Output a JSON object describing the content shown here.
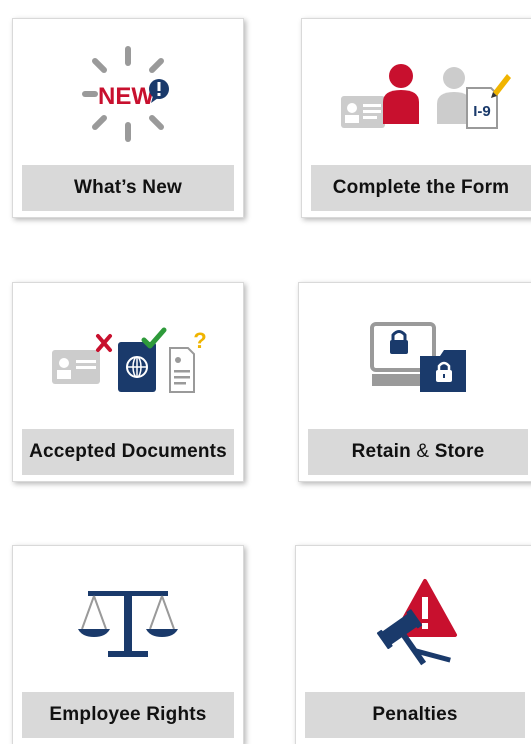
{
  "tiles": [
    {
      "label": "What’s New",
      "icon": "new-icon"
    },
    {
      "label": "Complete the Form",
      "icon": "form-icon"
    },
    {
      "label": "Accepted Documents",
      "icon": "documents-icon"
    },
    {
      "label_main": "Retain",
      "label_amp": "&",
      "label_end": "Store",
      "icon": "lock-icon"
    },
    {
      "label": "Employee Rights",
      "icon": "scales-icon"
    },
    {
      "label": "Penalties",
      "icon": "gavel-icon"
    }
  ],
  "icon_text": {
    "new_badge": "NEW",
    "form_badge": "I-9"
  },
  "colors": {
    "navy": "#1a3a6b",
    "red": "#c8102e",
    "gray": "#9a9a9a",
    "light_gray": "#cccccc",
    "green": "#2e9a3a",
    "yellow": "#f0b400",
    "label_bar": "#d9d9d9"
  }
}
